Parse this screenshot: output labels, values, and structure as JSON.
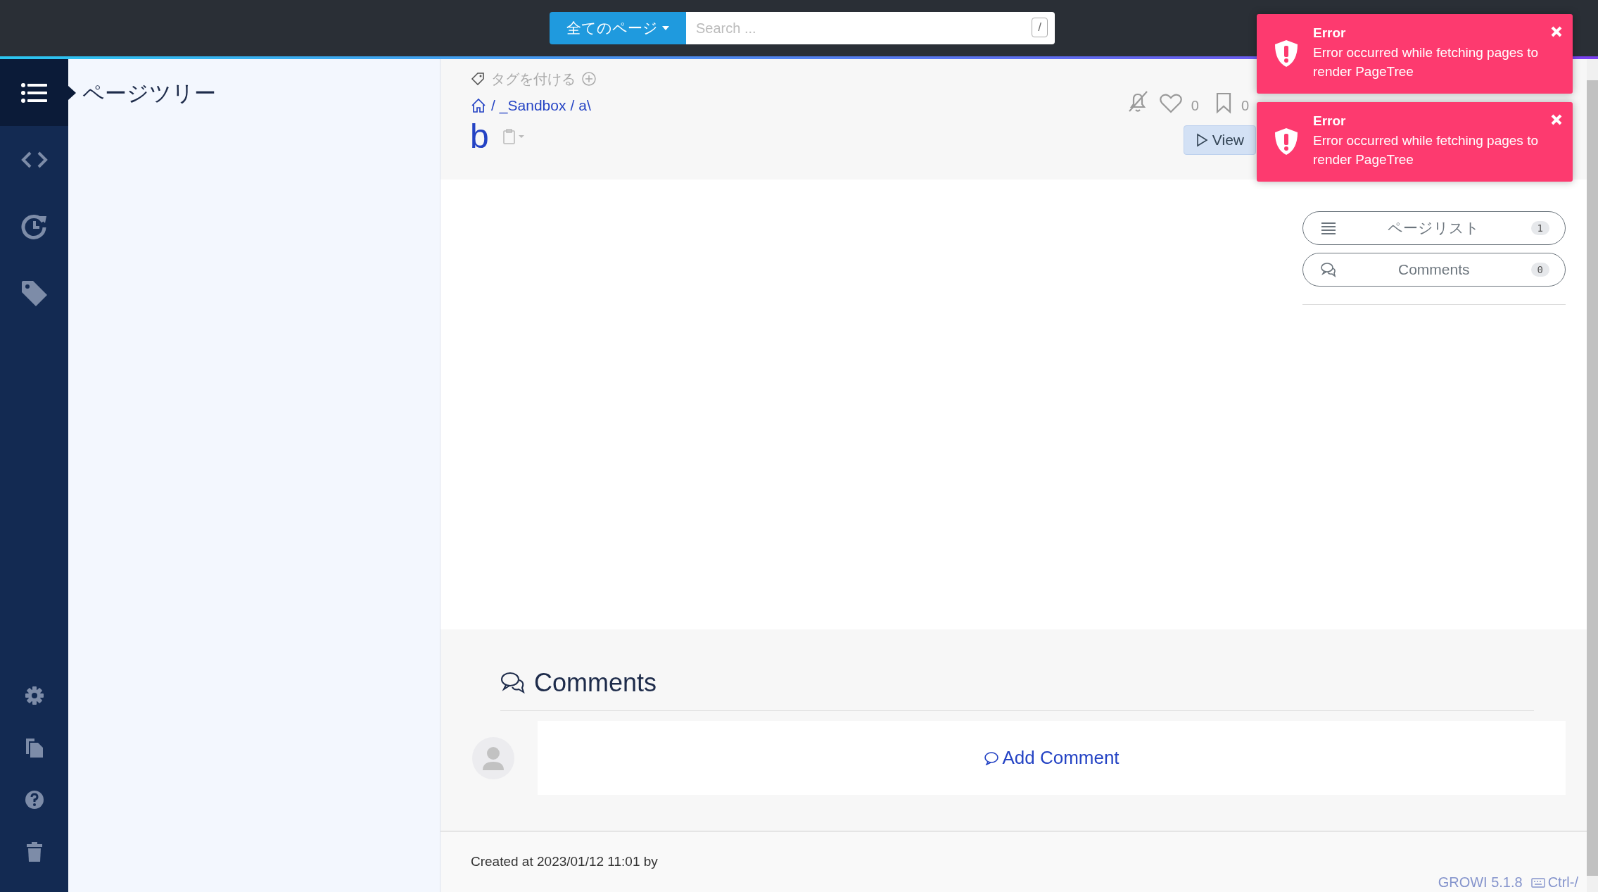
{
  "navbar": {
    "search_scope": "全てのページ",
    "search": {
      "placeholder": "Search ..."
    },
    "shortcut_key": "/"
  },
  "sidebar": {
    "nav_items": [
      {
        "kind": "page-tree",
        "selected": true
      },
      {
        "kind": "custom-sidebar",
        "selected": false
      },
      {
        "kind": "recent-changes",
        "selected": false
      },
      {
        "kind": "tags",
        "selected": false
      }
    ],
    "bottom_items": [
      {
        "kind": "settings"
      },
      {
        "kind": "copy"
      },
      {
        "kind": "help"
      },
      {
        "kind": "trash"
      }
    ],
    "panel_title": "ページツリー"
  },
  "page": {
    "tag_label": "タグを付ける",
    "path_segments": [
      "/",
      "_Sandbox",
      "/",
      "a\\"
    ],
    "title": "b",
    "like_count": "0",
    "bookmark_count": "0",
    "view_button": "View"
  },
  "side_buttons": [
    {
      "kind": "page-list",
      "label": "ページリスト",
      "count": "1"
    },
    {
      "kind": "comments",
      "label": "Comments",
      "count": "0"
    }
  ],
  "comments": {
    "title": "Comments",
    "add_label": "Add Comment"
  },
  "footer": {
    "created": "Created at 2023/01/12 11:01 by",
    "version": "GROWI 5.1.8",
    "shortcut": "Ctrl-/"
  },
  "toasts": [
    {
      "title": "Error",
      "message": "Error occurred while fetching pages to render PageTree"
    },
    {
      "title": "Error",
      "message": "Error occurred while fetching pages to render PageTree"
    }
  ]
}
